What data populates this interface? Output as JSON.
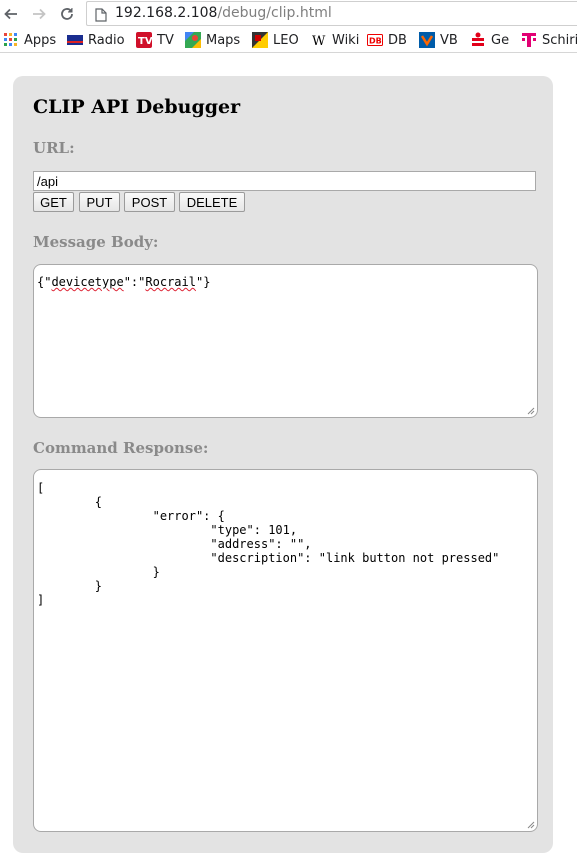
{
  "browser": {
    "url_host": "192.168.2.108",
    "url_path": "/debug/clip.html",
    "bookmarks": [
      "Apps",
      "Radio",
      "TV",
      "Maps",
      "LEO",
      "Wiki",
      "DB",
      "VB",
      "Ge",
      "Schiri"
    ]
  },
  "page": {
    "title": "CLIP API Debugger",
    "url_label": "URL:",
    "url_value": "/api",
    "buttons": {
      "get": "GET",
      "put": "PUT",
      "post": "POST",
      "delete": "DELETE"
    },
    "body_label": "Message Body:",
    "body_prefix": "{\"",
    "body_word1": "devicetype",
    "body_middle": "\":\"",
    "body_word2": "Rocrail",
    "body_suffix": "\"}",
    "response_label": "Command Response:",
    "response_text": "[\n        {\n                \"error\": {\n                        \"type\": 101,\n                        \"address\": \"\",\n                        \"description\": \"link button not pressed\"\n                }\n        }\n]"
  }
}
